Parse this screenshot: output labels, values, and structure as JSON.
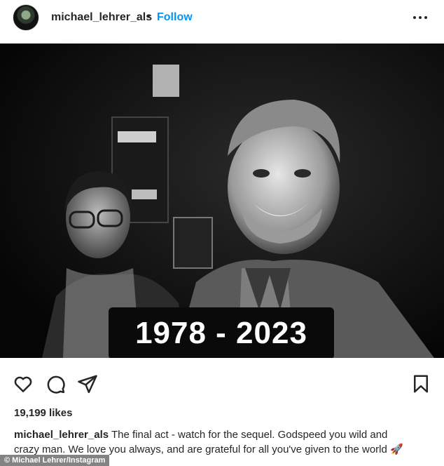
{
  "post": {
    "username": "michael_lehrer_als",
    "separator": "•",
    "follow_label": "Follow",
    "more_icon": "more-horizontal-icon"
  },
  "photo": {
    "overlay_text": "1978 - 2023",
    "tone": "black-and-white"
  },
  "actions": {
    "like_icon": "heart-icon",
    "comment_icon": "comment-icon",
    "share_icon": "paper-plane-icon",
    "save_icon": "bookmark-icon"
  },
  "likes_text": "19,199 likes",
  "caption": {
    "username": "michael_lehrer_als",
    "line1": "The final act - watch for the sequel. Godspeed you wild and",
    "line2": "crazy man. We love you always, and are grateful for all you've given to the world",
    "emoji": "🚀"
  },
  "credit_text": "© Michael Lehrer/Instagram"
}
